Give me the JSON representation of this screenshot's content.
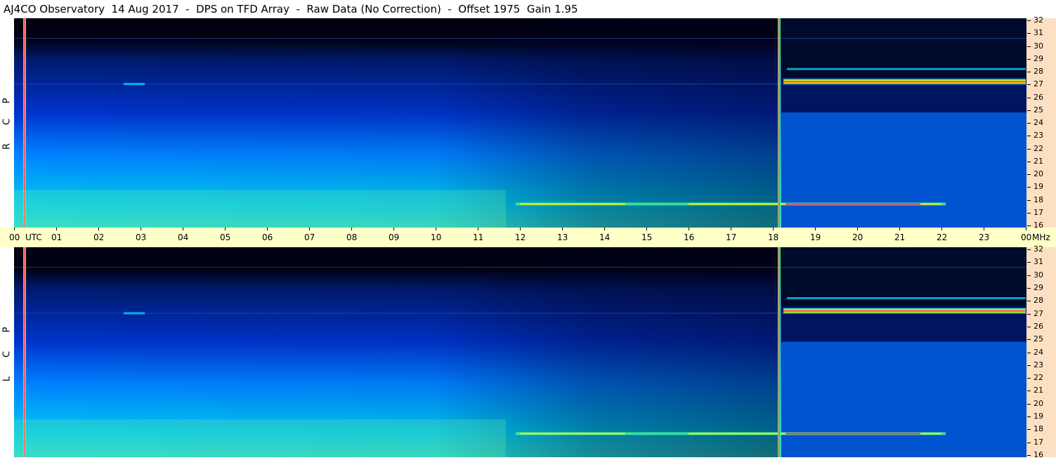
{
  "title": "AJ4CO Observatory  14 Aug 2017  -  DPS on TFD Array  -  Raw Data (No Correction)  -  Offset 1975  Gain 1.95",
  "panels": [
    {
      "id": "rcp",
      "label_letters": [
        "P",
        "C",
        "R"
      ]
    },
    {
      "id": "lcp",
      "label_letters": [
        "P",
        "C",
        "L"
      ]
    }
  ],
  "time_axis": {
    "labels": [
      "00",
      "01",
      "02",
      "03",
      "04",
      "05",
      "06",
      "07",
      "08",
      "09",
      "10",
      "11",
      "12",
      "13",
      "14",
      "15",
      "16",
      "17",
      "18",
      "19",
      "20",
      "21",
      "22",
      "23",
      "00"
    ],
    "unit_left": "UTC",
    "unit_right": "MHz"
  },
  "freq_axis": {
    "labels": [
      "32",
      "31",
      "30",
      "29",
      "28",
      "27",
      "26",
      "25",
      "24",
      "23",
      "22",
      "21",
      "20",
      "19",
      "18",
      "17",
      "16"
    ]
  },
  "chart_data": {
    "type": "heatmap",
    "title": "AJ4CO Observatory  14 Aug 2017  -  DPS on TFD Array  -  Raw Data (No Correction)  -  Offset 1975  Gain 1.95",
    "x": {
      "label": "UTC",
      "range": [
        "00",
        "00"
      ],
      "ticks": [
        "00",
        "01",
        "02",
        "03",
        "04",
        "05",
        "06",
        "07",
        "08",
        "09",
        "10",
        "11",
        "12",
        "13",
        "14",
        "15",
        "16",
        "17",
        "18",
        "19",
        "20",
        "21",
        "22",
        "23",
        "00"
      ]
    },
    "y": {
      "label": "MHz",
      "range": [
        16,
        32
      ],
      "ticks": [
        32,
        31,
        30,
        29,
        28,
        27,
        26,
        25,
        24,
        23,
        22,
        21,
        20,
        19,
        18,
        17,
        16
      ]
    },
    "panels": [
      "RCP",
      "LCP"
    ],
    "colormap": [
      "#000010",
      "#001a6e",
      "#0033cc",
      "#0080ff",
      "#00c8f0",
      "#40f0a0",
      "#f0f000",
      "#ff3060",
      "#ffffff"
    ]
  }
}
